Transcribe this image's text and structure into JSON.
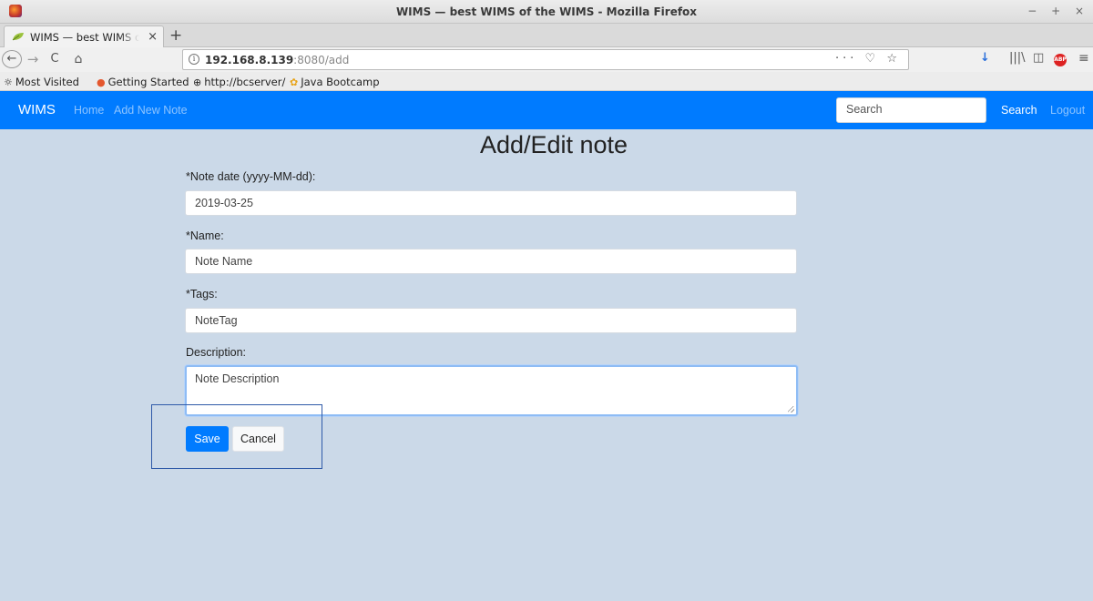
{
  "window": {
    "title": "WIMS — best WIMS of the WIMS - Mozilla Firefox",
    "controls": "− + ×"
  },
  "tabs": [
    {
      "title": "WIMS — best WIMS of the WIMS",
      "close": "×"
    }
  ],
  "new_tab": "+",
  "navbar": {
    "back": "←",
    "forward": "→",
    "reload": "C",
    "home": "⌂",
    "info": "i",
    "url_host": "192.168.8.139",
    "url_path": ":8080/add",
    "url_actions": "··· ♡ ☆",
    "toolbar": {
      "download": "↓",
      "library": "|||\\",
      "sidebar": "◫",
      "adblock": "ABP",
      "menu": "≡"
    }
  },
  "bookmarks": [
    {
      "icon": "☼",
      "label": "Most Visited"
    },
    {
      "icon": "●",
      "label": "Getting Started"
    },
    {
      "icon": "⊕",
      "label": "http://bcserver/"
    },
    {
      "icon": "✿",
      "label": "Java Bootcamp"
    }
  ],
  "app": {
    "brand": "WIMS",
    "links": [
      "Home",
      "Add New Note"
    ],
    "search_placeholder": "Search",
    "search_button": "Search",
    "logout": "Logout"
  },
  "form": {
    "title": "Add/Edit note",
    "date_label": "*Note date (yyyy-MM-dd):",
    "date_value": "2019-03-25",
    "name_label": "*Name:",
    "name_value": "Note Name",
    "tags_label": "*Tags:",
    "tags_value": "NoteTag",
    "description_label": "Description:",
    "description_value": "Note Description",
    "save_label": "Save",
    "cancel_label": "Cancel"
  },
  "colors": {
    "app_nav": "#007bff",
    "background": "#cbd9e8",
    "save_button": "#007bff",
    "highlight_box": "#2f5aa8"
  }
}
